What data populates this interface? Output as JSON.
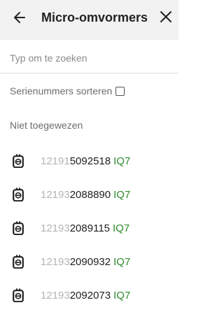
{
  "header": {
    "title": "Micro-omvormers",
    "back_icon": "arrow-left-icon",
    "close_icon": "close-icon"
  },
  "search": {
    "placeholder": "Typ om te zoeken",
    "value": ""
  },
  "sort": {
    "label": "Serienummers sorteren",
    "checked": false
  },
  "section": {
    "title": "Niet toegewezen"
  },
  "colors": {
    "header_bg": "#f2f2f2",
    "model_green": "#2e8b2e",
    "prefix_gray": "#b4b4b4"
  },
  "microinverters": [
    {
      "icon": "microinverter-icon",
      "serial_prefix": "12191",
      "serial_rest": "5092518",
      "model": "IQ7"
    },
    {
      "icon": "microinverter-icon",
      "serial_prefix": "12193",
      "serial_rest": "2088890",
      "model": "IQ7"
    },
    {
      "icon": "microinverter-icon",
      "serial_prefix": "12193",
      "serial_rest": "2089115",
      "model": "IQ7"
    },
    {
      "icon": "microinverter-icon",
      "serial_prefix": "12193",
      "serial_rest": "2090932",
      "model": "IQ7"
    },
    {
      "icon": "microinverter-icon",
      "serial_prefix": "12193",
      "serial_rest": "2092073",
      "model": "IQ7"
    }
  ]
}
